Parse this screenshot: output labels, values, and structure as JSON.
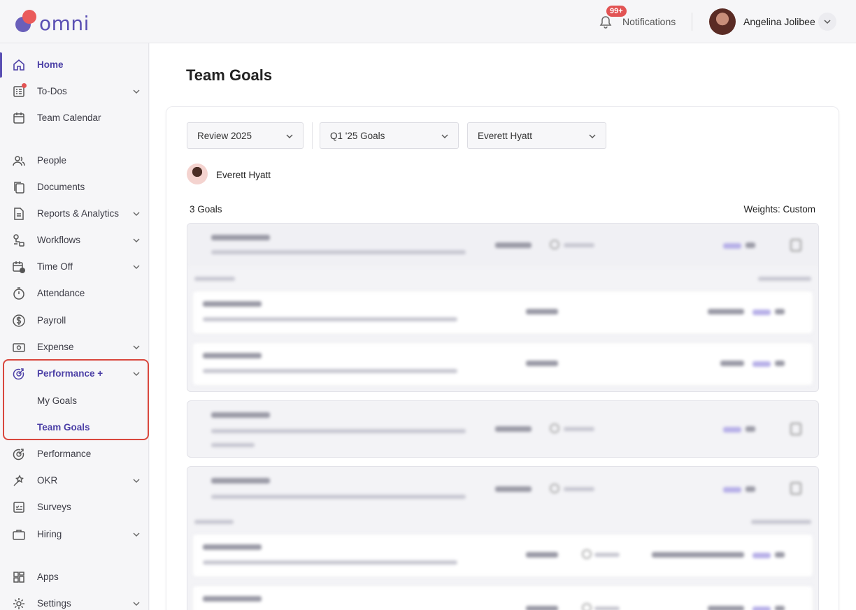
{
  "header": {
    "logo_text": "omni",
    "notifications_badge": "99+",
    "notifications_label": "Notifications",
    "user_name": "Angelina Jolibee"
  },
  "sidebar": {
    "items": [
      {
        "label": "Home",
        "icon": "home-icon",
        "active": true
      },
      {
        "label": "To-Dos",
        "icon": "checklist-icon"
      },
      {
        "label": "Team Calendar",
        "icon": "calendar-icon"
      },
      {
        "label": "People",
        "icon": "people-icon"
      },
      {
        "label": "Documents",
        "icon": "documents-icon"
      },
      {
        "label": "Reports & Analytics",
        "icon": "report-icon"
      },
      {
        "label": "Workflows",
        "icon": "workflow-icon"
      },
      {
        "label": "Time Off",
        "icon": "time-off-icon"
      },
      {
        "label": "Attendance",
        "icon": "stopwatch-icon"
      },
      {
        "label": "Payroll",
        "icon": "dollar-icon"
      },
      {
        "label": "Expense",
        "icon": "expense-icon"
      },
      {
        "label": "Performance +",
        "icon": "performance-icon"
      },
      {
        "label": "Performance",
        "icon": "performance-icon"
      },
      {
        "label": "OKR",
        "icon": "okr-icon"
      },
      {
        "label": "Surveys",
        "icon": "survey-icon"
      },
      {
        "label": "Hiring",
        "icon": "briefcase-icon"
      },
      {
        "label": "Apps",
        "icon": "apps-icon"
      },
      {
        "label": "Settings",
        "icon": "gear-icon"
      }
    ],
    "sub_items": [
      {
        "label": "My Goals"
      },
      {
        "label": "Team Goals"
      }
    ]
  },
  "main": {
    "title": "Team Goals",
    "filters": [
      {
        "value": "Review 2025"
      },
      {
        "value": "Q1 '25 Goals"
      },
      {
        "value": "Everett Hyatt"
      }
    ],
    "person_name": "Everett Hyatt",
    "goals_count": "3 Goals",
    "weights_label": "Weights: Custom"
  },
  "colors": {
    "accent": "#5a4fb3",
    "highlight": "#d9473d",
    "badge": "#e25454"
  }
}
